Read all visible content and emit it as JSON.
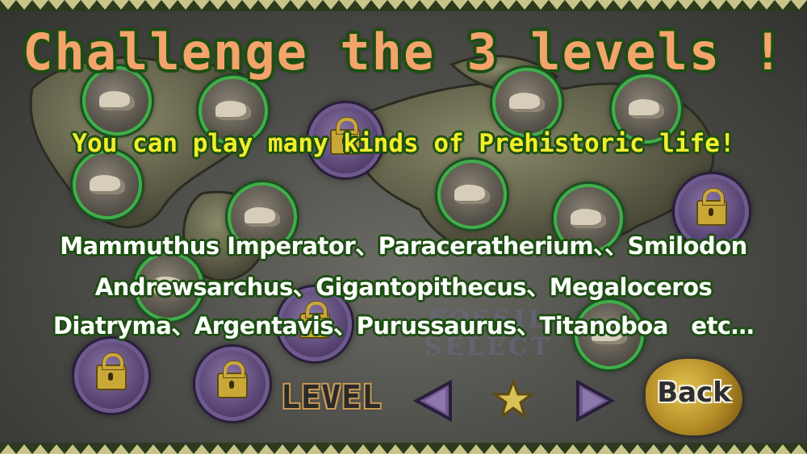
{
  "screen": {
    "title": "Challenge the 3 levels !",
    "subtitle": "You can play many kinds of Prehistoric life!",
    "species_lines": [
      "Mammuthus Imperator、Paraceratherium、、Smilodon",
      "Andrewsarchus、Gigantopithecus、Megaloceros",
      "Diatryma、Argentavis、Purussaurus、Titanoboa　etc…"
    ],
    "watermark": "FOSSIL\nSELECT"
  },
  "controls": {
    "level_label": "LEVEL",
    "back_label": "Back"
  },
  "colors": {
    "title": "#f4a36c",
    "subtitle": "#f2ee2a",
    "outline": "#1d4f12",
    "fossil_ring": "#3fae4a",
    "locked_ring": "#6e5a8e",
    "lock_gold": "#c9a838"
  },
  "icons": {
    "fossil_node": "fossil-skull-icon",
    "locked_node": "padlock-icon",
    "prev": "triangle-left-icon",
    "next": "triangle-right-icon",
    "level": "star-icon"
  }
}
